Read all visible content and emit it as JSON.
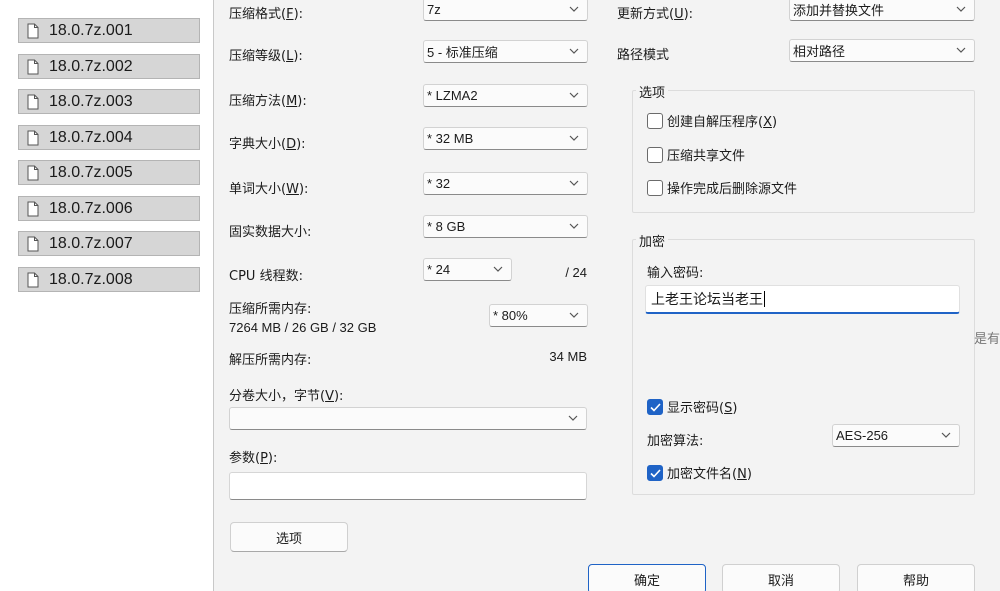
{
  "files": [
    "18.0.7z.001",
    "18.0.7z.002",
    "18.0.7z.003",
    "18.0.7z.004",
    "18.0.7z.005",
    "18.0.7z.006",
    "18.0.7z.007",
    "18.0.7z.008"
  ],
  "file_icon": "document-icon",
  "labels": {
    "format_pre": "压缩格式(",
    "format_key": "F",
    "format_post": "):",
    "level_pre": "压缩等级(",
    "level_key": "L",
    "level_post": "):",
    "method_pre": "压缩方法(",
    "method_key": "M",
    "method_post": "):",
    "dict_pre": "字典大小(",
    "dict_key": "D",
    "dict_post": "):",
    "word_pre": "单词大小(",
    "word_key": "W",
    "word_post": "):",
    "solid": "固实数据大小:",
    "threads": "CPU 线程数:",
    "mem_compress": "压缩所需内存:",
    "mem_compress_value": "7264 MB / 26 GB / 32 GB",
    "mem_decompress": "解压所需内存:",
    "mem_decompress_value": "34 MB",
    "split_pre": "分卷大小，字节(",
    "split_key": "V",
    "split_post": "):",
    "params_pre": "参数(",
    "params_key": "P",
    "params_post": "):",
    "update_pre": "更新方式(",
    "update_key": "U",
    "update_post": "):",
    "path_mode": "路径模式",
    "threads_total": "/ 24"
  },
  "values": {
    "format": "7z",
    "level": "5 - 标准压缩",
    "method": "* LZMA2",
    "dict": "* 32 MB",
    "word": "* 32",
    "solid": "* 8 GB",
    "threads": "* 24",
    "mem_percent": "* 80%",
    "split": "",
    "params": "",
    "update": "添加并替换文件",
    "path_mode": "相对路径"
  },
  "options": {
    "title": "选项",
    "sfx_pre": "创建自解压程序(",
    "sfx_key": "X",
    "sfx_post": ")",
    "sfx_checked": false,
    "shared": "压缩共享文件",
    "shared_checked": false,
    "delete": "操作完成后删除源文件",
    "delete_checked": false
  },
  "encryption": {
    "title": "加密",
    "password_label": "输入密码:",
    "password_value": "上老王论坛当老王",
    "show_pre": "显示密码(",
    "show_key": "S",
    "show_post": ")",
    "show_checked": true,
    "algo_label": "加密算法:",
    "algo_value": "AES-256",
    "names_pre": "加密文件名(",
    "names_key": "N",
    "names_post": ")",
    "names_checked": true
  },
  "buttons": {
    "options": "选项",
    "ok": "确定",
    "cancel": "取消",
    "help": "帮助"
  },
  "edge_text": "是有",
  "colors": {
    "accent": "#1f63c6",
    "dialog_bg": "#f3f3f3",
    "file_bg": "#d6d6d6"
  }
}
